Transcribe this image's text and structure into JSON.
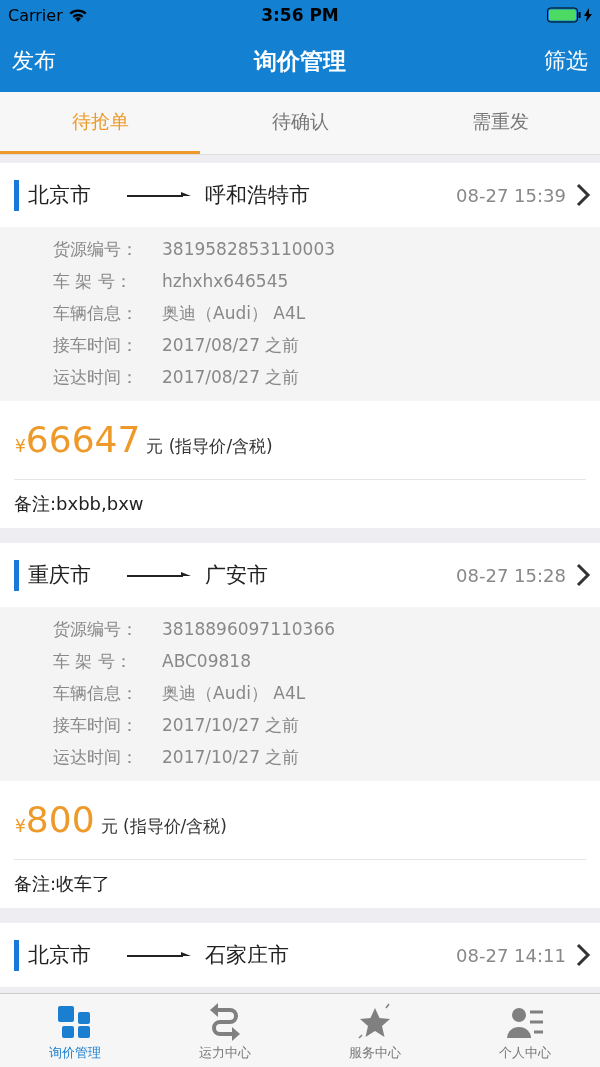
{
  "status_bar": {
    "carrier": "Carrier",
    "time": "3:56 PM"
  },
  "nav": {
    "left": "发布",
    "title": "询价管理",
    "right": "筛选"
  },
  "tabs": [
    {
      "label": "待抢单",
      "selected": true
    },
    {
      "label": "待确认",
      "selected": false
    },
    {
      "label": "需重发",
      "selected": false
    }
  ],
  "orders": [
    {
      "from": "北京市",
      "to": "呼和浩特市",
      "time": "08-27 15:39",
      "details": [
        {
          "label": "货源编号：",
          "value": "3819582853110003"
        },
        {
          "label": "车 架 号：",
          "value": "hzhxhx646545"
        },
        {
          "label": "车辆信息：",
          "value": "奥迪（Audi） A4L"
        },
        {
          "label": "接车时间：",
          "value": "2017/08/27 之前"
        },
        {
          "label": "运达时间：",
          "value": "2017/08/27 之前"
        }
      ],
      "currency": "¥",
      "price": "66647",
      "unit": "元 (指导价/含税)",
      "note": "备注:bxbb,bxw"
    },
    {
      "from": "重庆市",
      "to": "广安市",
      "time": "08-27 15:28",
      "details": [
        {
          "label": "货源编号：",
          "value": "3818896097110366"
        },
        {
          "label": "车 架 号：",
          "value": "ABC09818"
        },
        {
          "label": "车辆信息：",
          "value": "奥迪（Audi） A4L"
        },
        {
          "label": "接车时间：",
          "value": "2017/10/27 之前"
        },
        {
          "label": "运达时间：",
          "value": "2017/10/27 之前"
        }
      ],
      "currency": "¥",
      "price": "800",
      "unit": "元 (指导价/含税)",
      "note": "备注:收车了"
    },
    {
      "from": "北京市",
      "to": "石家庄市",
      "time": "08-27 14:11"
    }
  ],
  "tab_bar": [
    {
      "kind": "grid",
      "label": "询价管理",
      "selected": true
    },
    {
      "kind": "swap",
      "label": "运力中心",
      "selected": false
    },
    {
      "kind": "star",
      "label": "服务中心",
      "selected": false
    },
    {
      "kind": "person",
      "label": "个人中心",
      "selected": false
    }
  ]
}
